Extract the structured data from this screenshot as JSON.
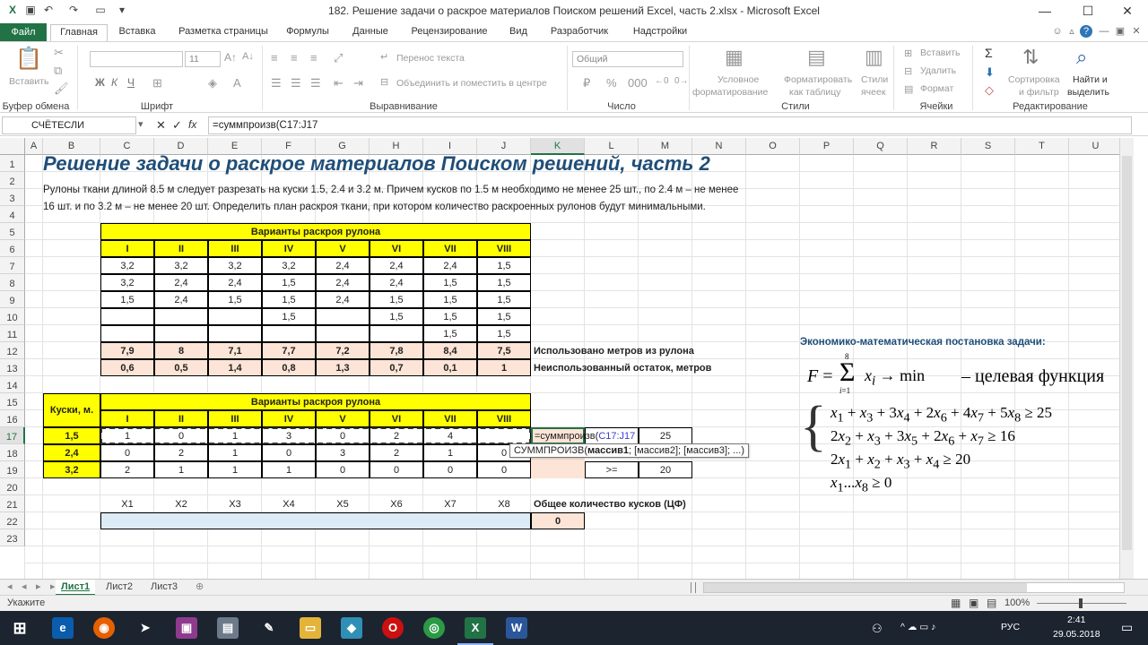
{
  "window": {
    "title": "182. Решение задачи о раскрое материалов Поиском решений Excel, часть 2.xlsx  -  Microsoft Excel",
    "min": "—",
    "max": "☐",
    "close": "✕",
    "help": "?"
  },
  "tabs": [
    "Файл",
    "Главная",
    "Вставка",
    "Разметка страницы",
    "Формулы",
    "Данные",
    "Рецензирование",
    "Вид",
    "Разработчик",
    "Надстройки"
  ],
  "ribbon": {
    "paste": "Вставить",
    "clipboard": "Буфер обмена",
    "font_group": "Шрифт",
    "font_size": "11",
    "wrap": "Перенос текста",
    "merge": "Объединить и поместить в центре",
    "alignment": "Выравнивание",
    "number_format": "Общий",
    "number": "Число",
    "cond1": "Условное",
    "cond2": "форматирование",
    "fmt1": "Форматировать",
    "fmt2": "как таблицу",
    "st1": "Стили",
    "st2": "ячеек",
    "styles": "Стили",
    "insert": "Вставить",
    "delete": "Удалить",
    "format": "Формат",
    "cells": "Ячейки",
    "sort1": "Сортировка",
    "sort2": "и фильтр",
    "find1": "Найти и",
    "find2": "выделить",
    "editing": "Редактирование",
    "bold": "Ж",
    "italic": "К",
    "underline": "Ч",
    "sigma": "Σ"
  },
  "formula_bar": {
    "name_box": "СЧЁТЕСЛИ",
    "cancel": "✕",
    "enter": "✓",
    "fx": "fx",
    "formula": "=суммпроизв(C17:J17"
  },
  "columns": [
    "A",
    "B",
    "C",
    "D",
    "E",
    "F",
    "G",
    "H",
    "I",
    "J",
    "K",
    "L",
    "M",
    "N",
    "O",
    "P",
    "Q",
    "R",
    "S",
    "T",
    "U"
  ],
  "rows": [
    "1",
    "2",
    "3",
    "4",
    "5",
    "6",
    "7",
    "8",
    "9",
    "10",
    "11",
    "12",
    "13",
    "14",
    "15",
    "16",
    "17",
    "18",
    "19",
    "20",
    "21",
    "22",
    "23"
  ],
  "sheet": {
    "title": "Решение задачи о раскрое материалов Поиском решений, часть 2",
    "desc1": "Рулоны ткани длиной 8.5 м следует разрезать на куски 1.5, 2.4 и 3.2 м. Причем кусков по 1.5 м необходимо не менее 25 шт., по 2.4 м – не менее",
    "desc2": "16 шт. и по 3.2 м – не менее 20 шт. Определить план раскроя ткани, при котором количество раскроенных рулонов будут минимальными.",
    "table1_header": "Варианты раскроя рулона",
    "variants": [
      "I",
      "II",
      "III",
      "IV",
      "V",
      "VI",
      "VII",
      "VIII"
    ],
    "cuts": [
      [
        "3,2",
        "3,2",
        "3,2",
        "3,2",
        "2,4",
        "2,4",
        "2,4",
        "1,5"
      ],
      [
        "3,2",
        "2,4",
        "2,4",
        "1,5",
        "2,4",
        "2,4",
        "1,5",
        "1,5"
      ],
      [
        "1,5",
        "2,4",
        "1,5",
        "1,5",
        "2,4",
        "1,5",
        "1,5",
        "1,5"
      ],
      [
        "",
        "",
        "",
        "1,5",
        "",
        "1,5",
        "1,5",
        "1,5"
      ],
      [
        "",
        "",
        "",
        "",
        "",
        "",
        "1,5",
        "1,5"
      ]
    ],
    "used": [
      "7,9",
      "8",
      "7,1",
      "7,7",
      "7,2",
      "7,8",
      "8,4",
      "7,5"
    ],
    "rest": [
      "0,6",
      "0,5",
      "1,4",
      "0,8",
      "1,3",
      "0,7",
      "0,1",
      "1"
    ],
    "used_label": "Использовано метров из рулона",
    "rest_label": "Неиспользованный остаток, метров",
    "table2_header": "Варианты раскроя рулона",
    "pieces_label": "Куски, м.",
    "pieces": [
      "1,5",
      "2,4",
      "3,2"
    ],
    "matrix": [
      [
        "1",
        "0",
        "1",
        "3",
        "0",
        "2",
        "4",
        ""
      ],
      [
        "0",
        "2",
        "1",
        "0",
        "3",
        "2",
        "1",
        "0"
      ],
      [
        "2",
        "1",
        "1",
        "1",
        "0",
        "0",
        "0",
        "0"
      ]
    ],
    "k17_edit": "=суммпроизв(",
    "k17_ref": "C17:J17",
    "m17": "25",
    "l19": ">=",
    "m19": "20",
    "tooltip_fn": "СУММПРОИЗВ(",
    "tooltip_arg": "массив1",
    "tooltip_rest": "; [массив2]; [массив3]; ...)",
    "xlabels": [
      "X1",
      "X2",
      "X3",
      "X4",
      "X5",
      "X6",
      "X7",
      "X8"
    ],
    "objective_label": "Общее количество кусков (ЦФ)",
    "objective_value": "0",
    "math_title": "Экономико-математическая постановка задачи:",
    "goal_text": "– целевая функция"
  },
  "sheet_tabs": [
    "Лист1",
    "Лист2",
    "Лист3"
  ],
  "status": {
    "mode": "Укажите",
    "zoom": "100%"
  },
  "taskbar": {
    "lang": "РУС",
    "time": "2:41",
    "date": "29.05.2018"
  }
}
